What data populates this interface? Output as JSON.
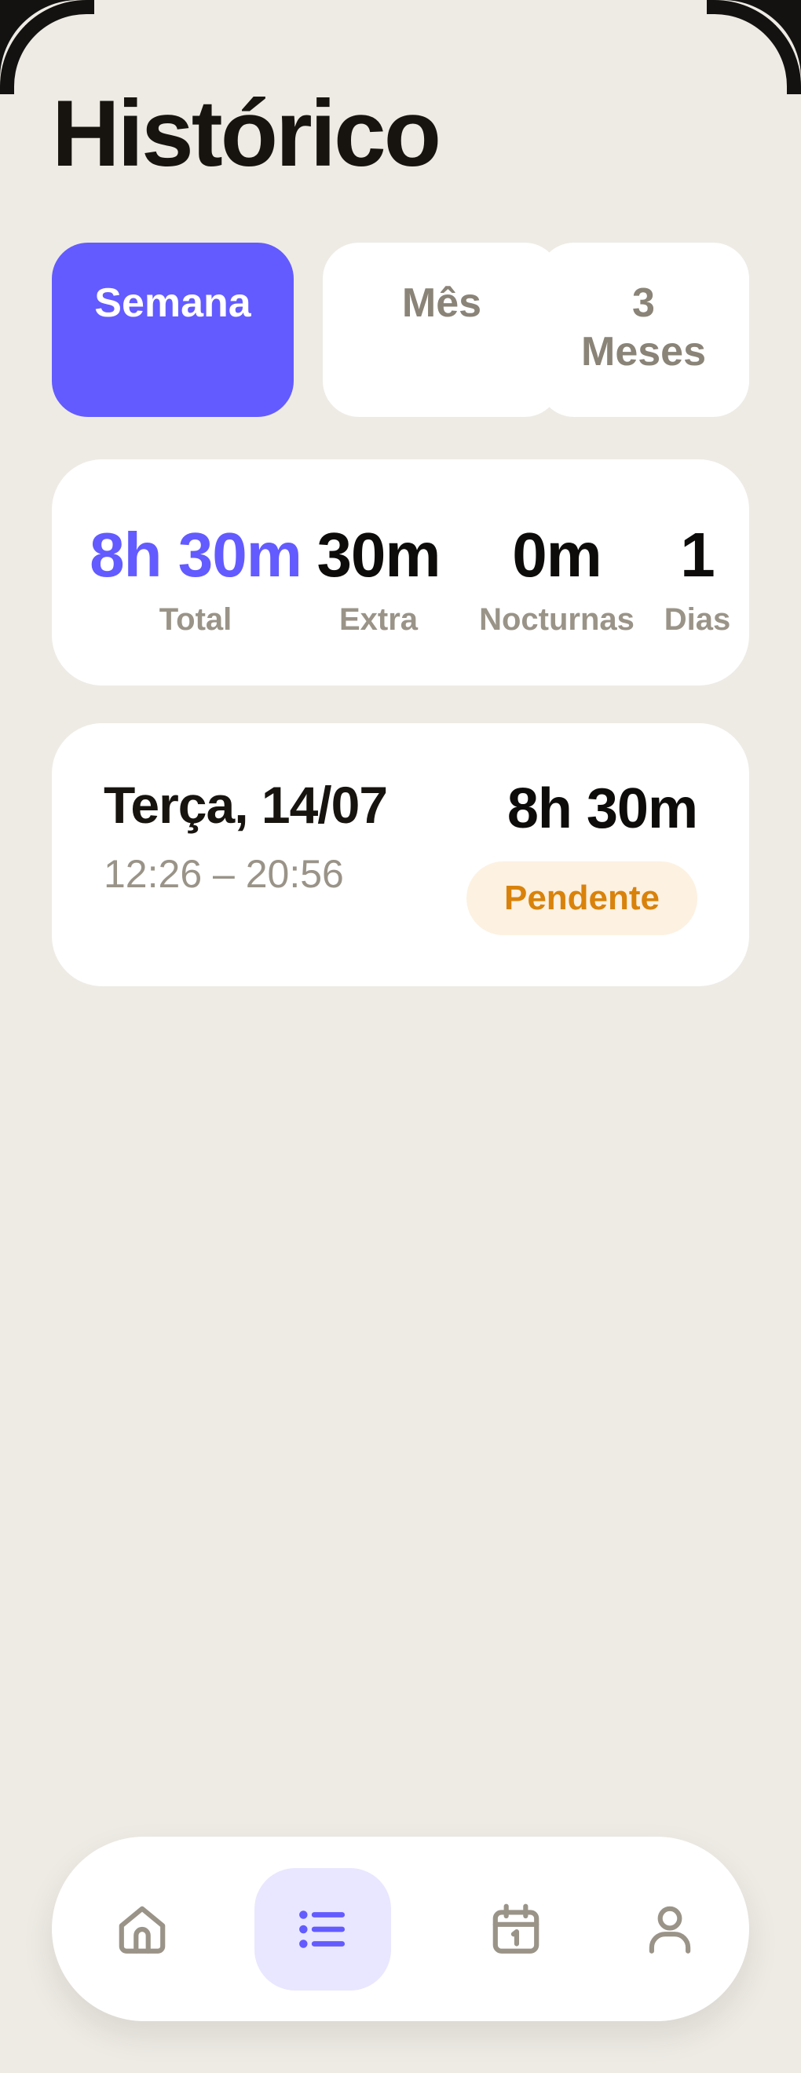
{
  "header": {
    "title": "Histórico"
  },
  "period_tabs": [
    {
      "label": "Semana",
      "active": true
    },
    {
      "label": "Mês",
      "active": false
    },
    {
      "label": "3 Meses",
      "active": false
    }
  ],
  "summary": {
    "total": {
      "value": "8h 30m",
      "label": "Total"
    },
    "extra": {
      "value": "30m",
      "label": "Extra"
    },
    "night": {
      "value": "0m",
      "label": "Nocturnas"
    },
    "days": {
      "value": "1",
      "label": "Dias"
    }
  },
  "entries": [
    {
      "date": "Terça, 14/07",
      "time_range": "12:26 – 20:56",
      "duration": "8h 30m",
      "status": "Pendente"
    }
  ],
  "bottom_nav": [
    {
      "icon": "home-icon",
      "active": false
    },
    {
      "icon": "list-icon",
      "active": true
    },
    {
      "icon": "calendar-icon",
      "active": false
    },
    {
      "icon": "user-icon",
      "active": false
    }
  ],
  "colors": {
    "accent": "#635bff",
    "accent_soft": "#e9e7ff",
    "background": "#eeebe5",
    "pending_text": "#d9820b",
    "pending_bg": "#fdf1e1",
    "muted": "#9a9388"
  }
}
